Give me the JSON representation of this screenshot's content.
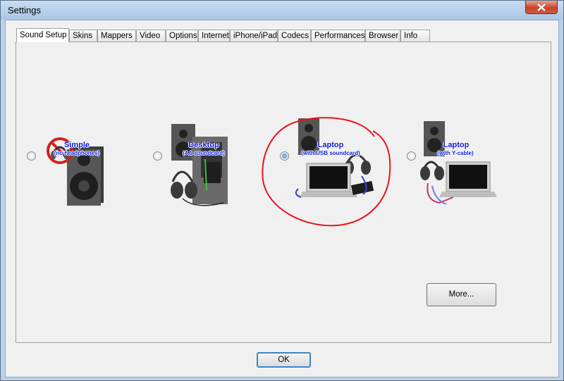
{
  "window": {
    "title": "Settings"
  },
  "tabs": [
    "Sound Setup",
    "Skins",
    "Mappers",
    "Video",
    "Options",
    "Internet",
    "iPhone/iPad",
    "Codecs",
    "Performances",
    "Browser",
    "Info"
  ],
  "options": [
    {
      "title": "Simple",
      "subtitle": "(no headphones)",
      "selected": false
    },
    {
      "title": "Desktop",
      "subtitle": "(4.1 soundcard)",
      "selected": false
    },
    {
      "title": "Laptop",
      "subtitle": "(with USB soundcard)",
      "selected": true
    },
    {
      "title": "Laptop",
      "subtitle": "(with Y-cable)",
      "selected": false
    }
  ],
  "buttons": {
    "more": "More...",
    "ok": "OK"
  },
  "annotation": {
    "highlight_color": "#e8141c"
  }
}
